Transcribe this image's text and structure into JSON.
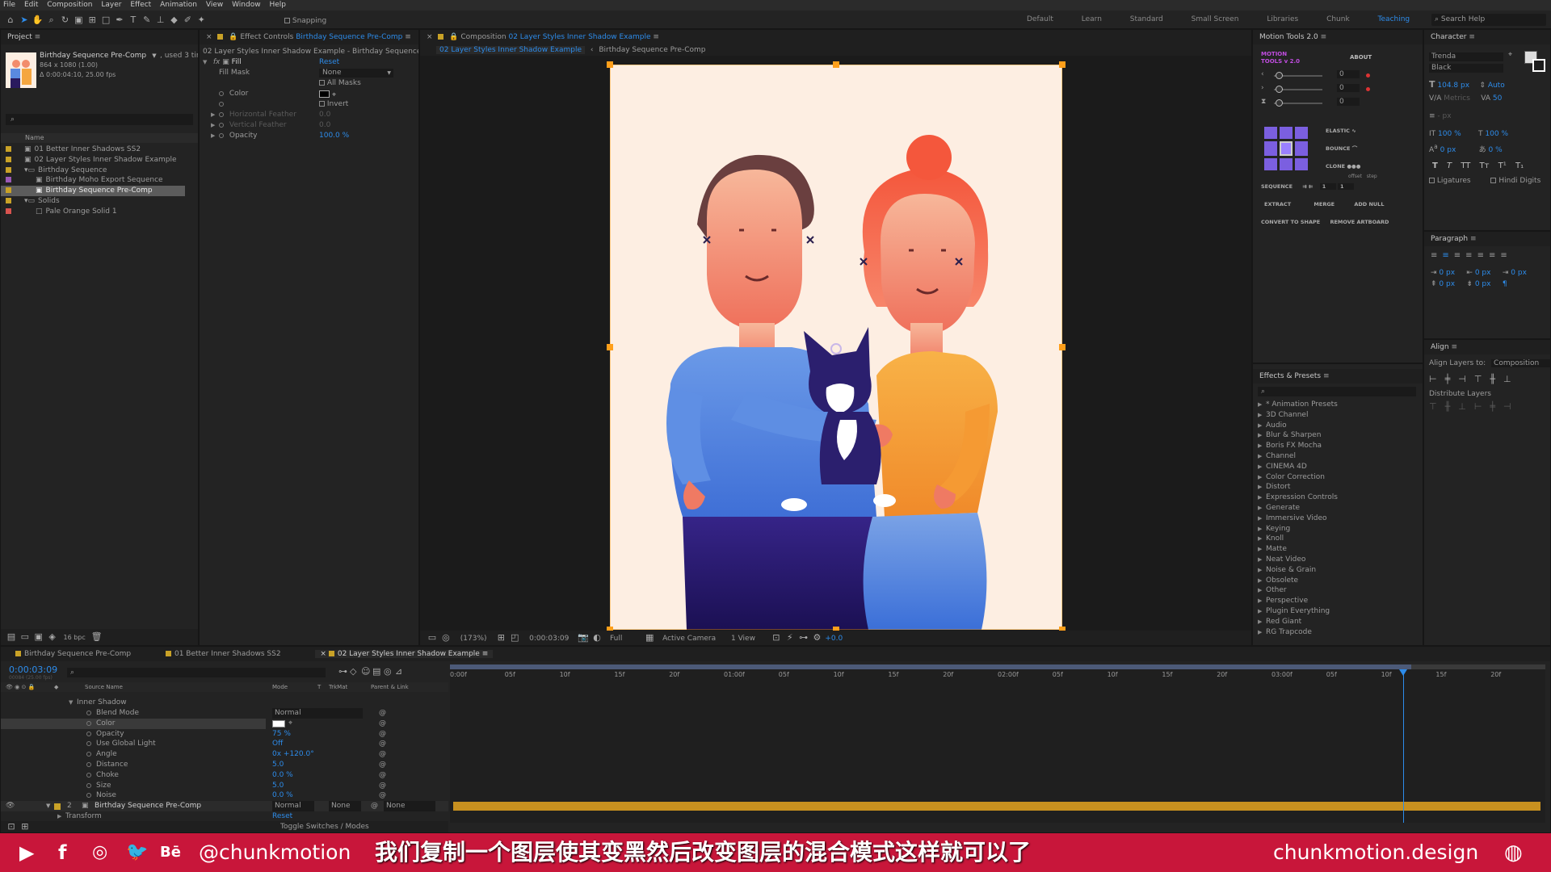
{
  "menu": [
    "File",
    "Edit",
    "Composition",
    "Layer",
    "Effect",
    "Animation",
    "View",
    "Window",
    "Help"
  ],
  "toolbar": {
    "snapping_label": "Snapping"
  },
  "workspaces": [
    "Default",
    "Learn",
    "Standard",
    "Small Screen",
    "Libraries",
    "Chunk",
    "Teaching"
  ],
  "search_help": "Search Help",
  "project": {
    "tab": "Project",
    "item_name": "Birthday Sequence Pre-Comp",
    "used": ", used 3 times",
    "dims": "864 x 1080 (1.00)",
    "duration": "Δ 0:00:04:10, 25.00 fps",
    "col_name": "Name",
    "items": [
      {
        "label": "01 Better Inner Shadows SS2",
        "color": "#c9a227",
        "indent": 0,
        "type": "comp"
      },
      {
        "label": "02 Layer Styles Inner Shadow Example",
        "color": "#c9a227",
        "indent": 0,
        "type": "comp"
      },
      {
        "label": "Birthday Sequence",
        "color": "#c9a227",
        "indent": 0,
        "type": "folder"
      },
      {
        "label": "Birthday Moho Export Sequence",
        "color": "#9b59b6",
        "indent": 1,
        "type": "comp"
      },
      {
        "label": "Birthday Sequence Pre-Comp",
        "color": "#c9a227",
        "indent": 1,
        "type": "comp"
      },
      {
        "label": "Solids",
        "color": "#c9a227",
        "indent": 0,
        "type": "folder"
      },
      {
        "label": "Pale Orange Solid 1",
        "color": "#d9534f",
        "indent": 1,
        "type": "solid"
      }
    ],
    "bpc": "16 bpc"
  },
  "effect_controls": {
    "tab": "Effect Controls",
    "tab_layer": "Birthday Sequence Pre-Comp",
    "header": "02 Layer Styles Inner Shadow Example - Birthday Sequence Pre-Comp",
    "fx_name": "Fill",
    "reset": "Reset",
    "fill_mask_label": "Fill Mask",
    "fill_mask_value": "None",
    "all_masks": "All Masks",
    "color_label": "Color",
    "invert": "Invert",
    "h_feather": "Horizontal Feather",
    "h_feather_value": "0.0",
    "v_feather": "Vertical Feather",
    "v_feather_value": "0.0",
    "opacity_label": "Opacity",
    "opacity_value": "100.0 %"
  },
  "composition": {
    "tab_prefix": "Composition",
    "tab_name": "02 Layer Styles Inner Shadow Example",
    "flow_active": "02 Layer Styles Inner Shadow Example",
    "flow_other": "Birthday Sequence Pre-Comp",
    "zoom": "(173%)",
    "time": "0:00:03:09",
    "resolution": "Full",
    "camera": "Active Camera",
    "view": "1 View",
    "exposure": "+0.0"
  },
  "motion_tools": {
    "tab": "Motion Tools 2.0",
    "logo": "MOTION TOOLS v 2.0",
    "about": "ABOUT",
    "sliders": [
      "0",
      "0",
      "0"
    ],
    "elastic": "ELASTIC",
    "bounce": "BOUNCE",
    "clone": "CLONE",
    "offset": "offset",
    "step": "step",
    "sequence": "SEQUENCE",
    "seq_values": [
      "1",
      "1"
    ],
    "extract": "EXTRACT",
    "merge": "MERGE",
    "add_null": "ADD NULL",
    "convert": "CONVERT TO SHAPE",
    "remove_artboard": "REMOVE ARTBOARD"
  },
  "character": {
    "tab": "Character",
    "font": "Trenda",
    "style": "Black",
    "size": "104.8 px",
    "leading": "Auto",
    "kerning": "Metrics",
    "tracking": "50",
    "stroke": "- px",
    "v_scale": "100 %",
    "h_scale": "100 %",
    "baseline": "0 px",
    "tsume": "0 %",
    "ligatures": "Ligatures",
    "hindi": "Hindi Digits"
  },
  "paragraph": {
    "tab": "Paragraph",
    "values": [
      "0 px",
      "0 px",
      "0 px",
      "0 px",
      "0 px"
    ]
  },
  "align": {
    "tab": "Align",
    "align_to_label": "Align Layers to:",
    "align_to_value": "Composition",
    "distribute": "Distribute Layers"
  },
  "effects_presets": {
    "tab": "Effects & Presets",
    "items": [
      "* Animation Presets",
      "3D Channel",
      "Audio",
      "Blur & Sharpen",
      "Boris FX Mocha",
      "Channel",
      "CINEMA 4D",
      "Color Correction",
      "Distort",
      "Expression Controls",
      "Generate",
      "Immersive Video",
      "Keying",
      "Knoll",
      "Matte",
      "Neat Video",
      "Noise & Grain",
      "Obsolete",
      "Other",
      "Perspective",
      "Plugin Everything",
      "Red Giant",
      "RG Trapcode"
    ]
  },
  "timeline": {
    "tabs": [
      "Birthday Sequence Pre-Comp",
      "01 Better Inner Shadows SS2",
      "02 Layer Styles Inner Shadow Example"
    ],
    "timecode": "0:00:03:09",
    "frame_info": "00084 (25.00 fps)",
    "col_source": "Source Name",
    "col_mode": "Mode",
    "col_t": "T",
    "col_trkmat": "TrkMat",
    "col_parent": "Parent & Link",
    "group": "Inner Shadow",
    "props": [
      {
        "name": "Blend Mode",
        "value": "Normal"
      },
      {
        "name": "Color",
        "value": ""
      },
      {
        "name": "Opacity",
        "value": "75 %"
      },
      {
        "name": "Use Global Light",
        "value": "Off"
      },
      {
        "name": "Angle",
        "value": "0x +120.0°"
      },
      {
        "name": "Distance",
        "value": "5.0"
      },
      {
        "name": "Choke",
        "value": "0.0 %"
      },
      {
        "name": "Size",
        "value": "5.0"
      },
      {
        "name": "Noise",
        "value": "0.0 %"
      }
    ],
    "layer_num": "2",
    "layer_name": "Birthday Sequence Pre-Comp",
    "layer_mode": "Normal",
    "layer_trkmat": "None",
    "layer_parent": "None",
    "transform": "Transform",
    "transform_reset": "Reset",
    "toggle": "Toggle Switches / Modes",
    "ruler": [
      "0:00f",
      "05f",
      "10f",
      "15f",
      "20f",
      "01:00f",
      "05f",
      "10f",
      "15f",
      "20f",
      "02:00f",
      "05f",
      "10f",
      "15f",
      "20f",
      "03:00f",
      "05f",
      "10f",
      "15f",
      "20f"
    ],
    "playhead_fraction": 0.87
  },
  "overlay": {
    "handle": "@chunkmotion",
    "subtitle": "我们复制一个图层使其变黑然后改变图层的混合模式这样就可以了",
    "site": "chunkmotion.design",
    "bg_color": "#c8163a"
  },
  "colors": {
    "accent": "#2d8ceb",
    "layer_bar": "#c8901f",
    "artboard": "#fdeee2"
  }
}
